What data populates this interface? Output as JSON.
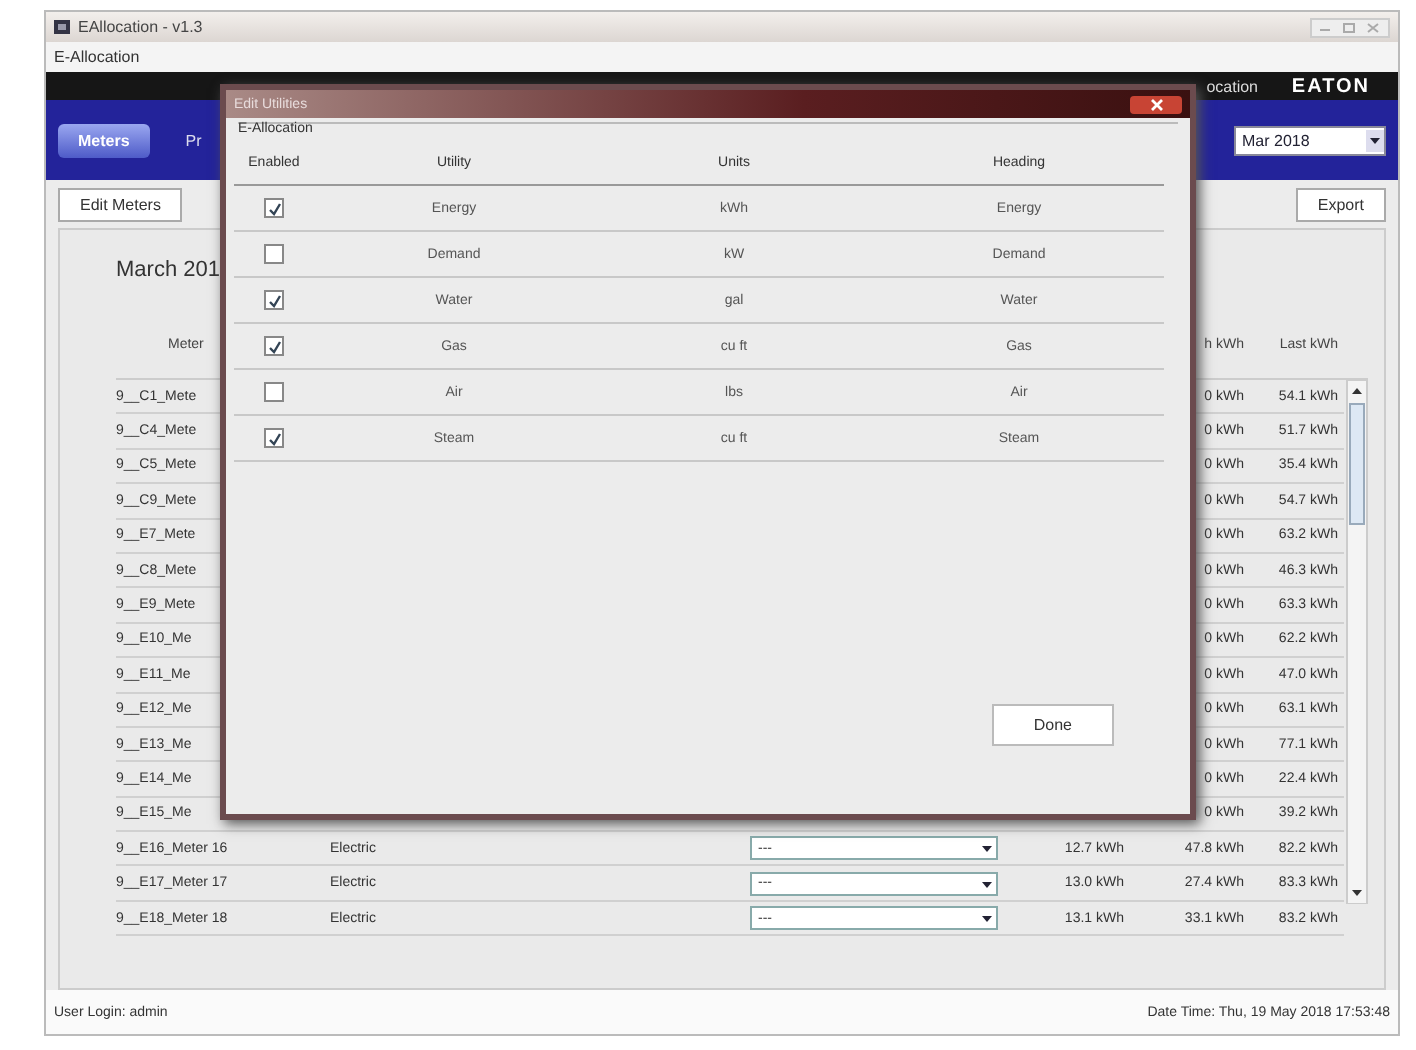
{
  "window": {
    "title": "EAllocation - v1.3"
  },
  "menu": [
    "E-Allocation"
  ],
  "header": {
    "tabs": [
      {
        "label": "Meters",
        "selected": true
      },
      {
        "label": "Pr",
        "selected": false
      }
    ],
    "caption": "ocation",
    "logo": "EATON",
    "month": "Mar 2018"
  },
  "toolbar": {
    "edit_button": "Edit Meters",
    "export_button": "Export"
  },
  "period": "March 201",
  "table": {
    "columns": [
      "Meter",
      "h kWh",
      "Last kWh"
    ],
    "rows": [
      {
        "name": "9__C1_Mete",
        "column_5": "0 kWh",
        "last": "54.1 kWh"
      },
      {
        "name": "9__C4_Mete",
        "column_5": "0 kWh",
        "last": "51.7 kWh"
      },
      {
        "name": "9__C5_Mete",
        "column_5": "0 kWh",
        "last": "35.4 kWh"
      },
      {
        "name": "9__C9_Mete",
        "column_5": "0 kWh",
        "last": "54.7 kWh"
      },
      {
        "name": "9__E7_Mete",
        "column_5": "0 kWh",
        "last": "63.2 kWh"
      },
      {
        "name": "9__C8_Mete",
        "column_5": "0 kWh",
        "last": "46.3 kWh"
      },
      {
        "name": "9__E9_Mete",
        "column_5": "0 kWh",
        "last": "63.3 kWh"
      },
      {
        "name": "9__E10_Me",
        "column_5": "0 kWh",
        "last": "62.2 kWh"
      },
      {
        "name": "9__E11_Me",
        "column_5": "0 kWh",
        "last": "47.0 kWh"
      },
      {
        "name": "9__E12_Me",
        "column_5": "0 kWh",
        "last": "63.1 kWh"
      },
      {
        "name": "9__E13_Me",
        "column_5": "0 kWh",
        "last": "77.1 kWh"
      },
      {
        "name": "9__E14_Me",
        "column_5": "0 kWh",
        "last": "22.4 kWh"
      },
      {
        "name": "9__E15_Me",
        "column_5": "0 kWh",
        "last": "39.2 kWh"
      },
      {
        "name": "9__E16_Meter 16",
        "type": "Electric",
        "selection": "---",
        "column_4": "12.7 kWh",
        "column_5": "47.8 kWh",
        "last": "82.2 kWh"
      },
      {
        "name": "9__E17_Meter 17",
        "type": "Electric",
        "selection": "---",
        "column_4": "13.0 kWh",
        "column_5": "27.4 kWh",
        "last": "83.3 kWh"
      },
      {
        "name": "9__E18_Meter 18",
        "type": "Electric",
        "selection": "---",
        "column_4": "13.1 kWh",
        "column_5": "33.1 kWh",
        "last": "83.2 kWh"
      }
    ]
  },
  "status_bar": {
    "user": "User Login: admin",
    "time": "Date Time: Thu, 19 May 2018 17:53:48"
  },
  "dialog": {
    "title": "Edit Utilities",
    "group": "E-Allocation",
    "columns": [
      "Enabled",
      "Utility",
      "Units",
      "Heading"
    ],
    "rows": [
      {
        "checked": true,
        "utility": "Energy",
        "units": "kWh",
        "heading": "Energy"
      },
      {
        "checked": false,
        "utility": "Demand",
        "units": "kW",
        "heading": "Demand"
      },
      {
        "checked": true,
        "utility": "Water",
        "units": "gal",
        "heading": "Water"
      },
      {
        "checked": true,
        "utility": "Gas",
        "units": "cu ft",
        "heading": "Gas"
      },
      {
        "checked": false,
        "utility": "Air",
        "units": "lbs",
        "heading": "Air"
      },
      {
        "checked": true,
        "utility": "Steam",
        "units": "cu ft",
        "heading": "Steam"
      }
    ],
    "done_button": "Done"
  }
}
